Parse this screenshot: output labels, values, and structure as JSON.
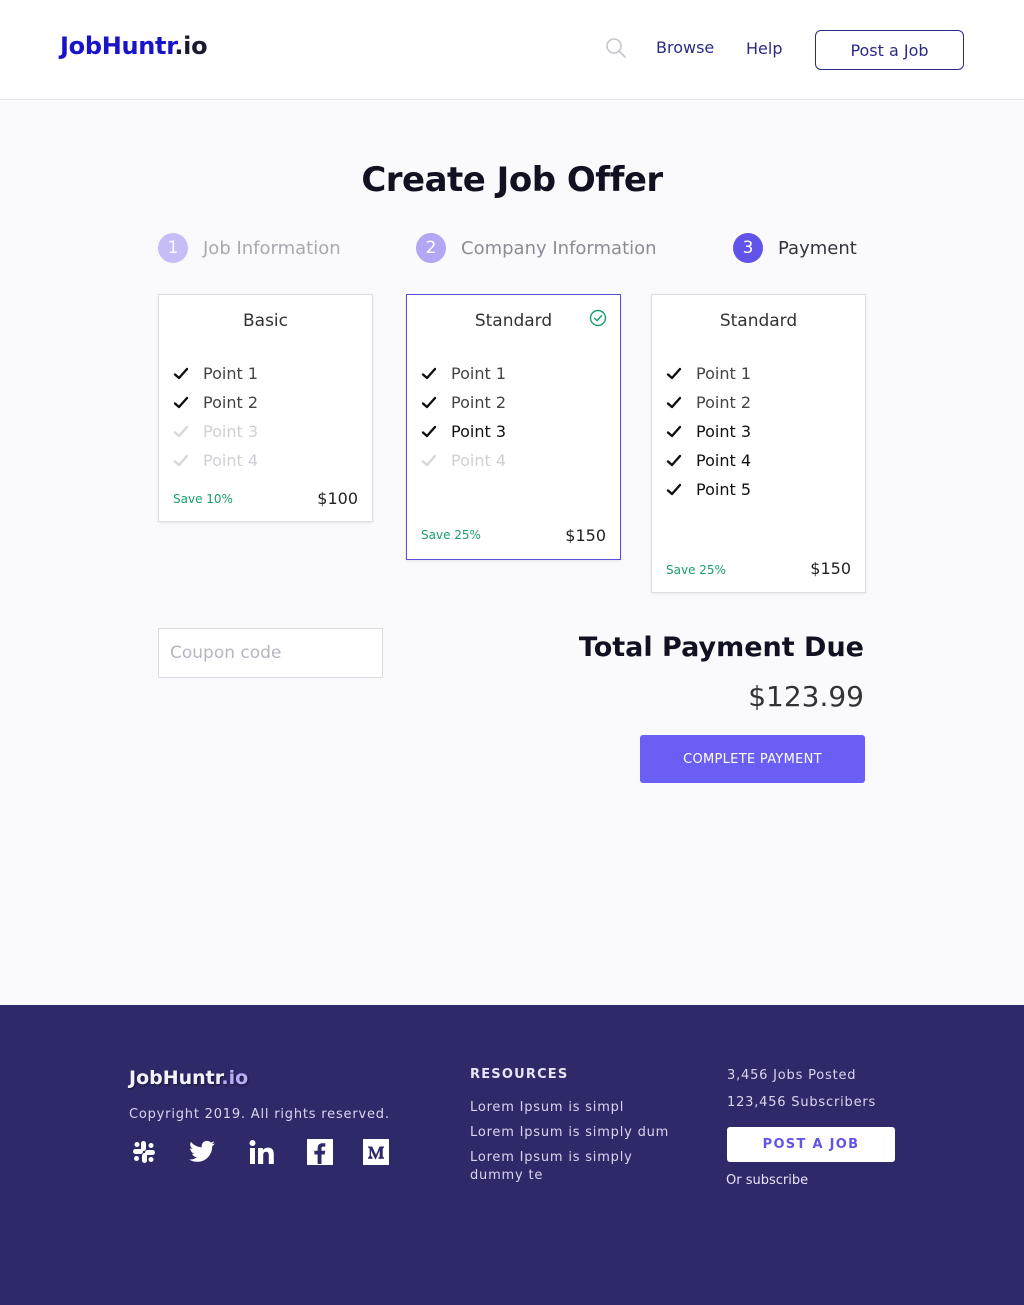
{
  "header": {
    "logo_main": "JobHuntr",
    "logo_suffix": ".io",
    "icons": {
      "search": "search-icon"
    },
    "nav": {
      "browse": "Browse",
      "help": "Help"
    },
    "post_button": "Post a Job"
  },
  "main": {
    "title": "Create Job Offer",
    "steps": [
      {
        "number": "1",
        "label": "Job Information",
        "state": "inactive"
      },
      {
        "number": "2",
        "label": "Company Information",
        "state": "inactive"
      },
      {
        "number": "3",
        "label": "Payment",
        "state": "active"
      }
    ],
    "plans": [
      {
        "name": "Basic",
        "selected": false,
        "points": [
          {
            "label": "Point 1",
            "included": true
          },
          {
            "label": "Point 2",
            "included": true
          },
          {
            "label": "Point 3",
            "included": false
          },
          {
            "label": "Point 4",
            "included": false
          }
        ],
        "save": "Save 10%",
        "price": "$100"
      },
      {
        "name": "Standard",
        "selected": true,
        "points": [
          {
            "label": "Point 1",
            "included": true
          },
          {
            "label": "Point 2",
            "included": true
          },
          {
            "label": "Point 3",
            "included": true
          },
          {
            "label": "Point 4",
            "included": false
          }
        ],
        "save": "Save 25%",
        "price": "$150"
      },
      {
        "name": "Standard",
        "selected": false,
        "points": [
          {
            "label": "Point 1",
            "included": true
          },
          {
            "label": "Point 2",
            "included": true
          },
          {
            "label": "Point 3",
            "included": true
          },
          {
            "label": "Point 4",
            "included": true
          },
          {
            "label": "Point 5",
            "included": true
          }
        ],
        "save": "Save 25%",
        "price": "$150"
      }
    ],
    "coupon": {
      "placeholder": "Coupon code",
      "value": ""
    },
    "total_label": "Total Payment Due",
    "total_value": "$123.99",
    "pay_button": "COMPLETE PAYMENT"
  },
  "footer": {
    "logo_main": "JobHuntr",
    "logo_suffix": ".io",
    "copyright": "Copyright 2019. All rights reserved.",
    "social_icons": [
      "slack-icon",
      "twitter-icon",
      "linkedin-icon",
      "facebook-icon",
      "medium-icon"
    ],
    "resources_title": "RESOURCES",
    "resources": [
      "Lorem Ipsum is simpl",
      "Lorem Ipsum is simply dum",
      "Lorem Ipsum is simply dummy te"
    ],
    "jobs_posted": "3,456 Jobs Posted",
    "subscribers": "123,456 Subscribers",
    "post_button": "POST A JOB",
    "subscribe_text": "Or subscribe"
  },
  "colors": {
    "brand": "#1a14c8",
    "accent": "#6254e8",
    "button": "#6a5ef4",
    "save_green": "#1a9e6a",
    "footer_bg": "#2e2a6a"
  }
}
